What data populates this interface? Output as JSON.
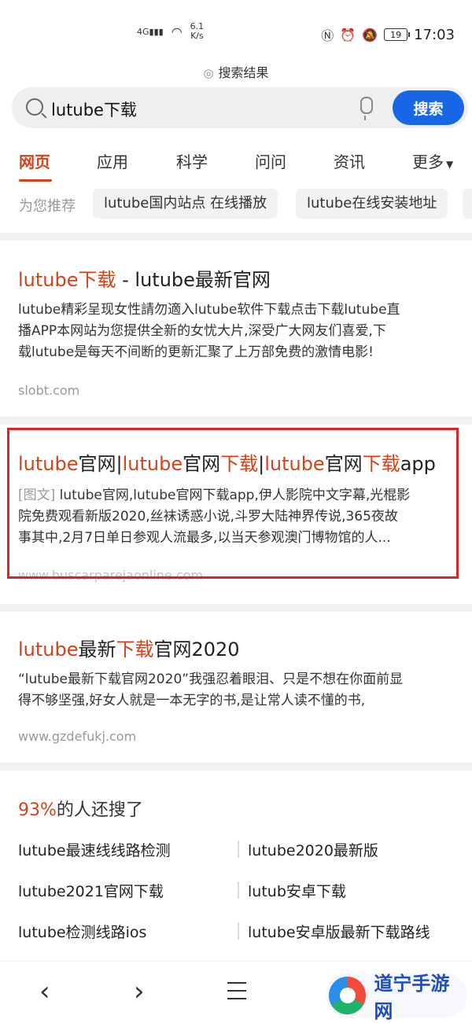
{
  "status_bar": {
    "network": "4G",
    "speed_value": "6.1",
    "speed_unit": "K/s",
    "battery": "19",
    "time": "17:03"
  },
  "header": {
    "label": "搜索结果"
  },
  "search": {
    "query": "lutube下载",
    "button_label": "搜索"
  },
  "tabs": [
    {
      "label": "网页",
      "active": true
    },
    {
      "label": "应用",
      "active": false
    },
    {
      "label": "科学",
      "active": false
    },
    {
      "label": "问问",
      "active": false
    },
    {
      "label": "资讯",
      "active": false
    },
    {
      "label": "更多",
      "active": false
    }
  ],
  "recommendations": {
    "label": "为您推荐",
    "chips": [
      "lutube国内站点 在线播放",
      "lutube在线安装地址"
    ]
  },
  "results": [
    {
      "title_parts": [
        "lutube下载",
        " - lutube最新官网"
      ],
      "snippet_lines": [
        "lutube精彩呈现女性請勿適入lutube软件下载点击下载lutube直",
        "播APP本网站为您提供全新的女忧大片,深受广大网友们喜爱,下",
        "载lutube是每天不间断的更新汇聚了上万部免费的激情电影!"
      ],
      "url": "slobt.com"
    },
    {
      "title_parts": [
        "lutube",
        "官网|",
        "lutube",
        "官网",
        "下载",
        "|",
        "lutube",
        "官网",
        "下载",
        "app"
      ],
      "tag": "[图文]",
      "snippet_lines": [
        "lutube官网,lutube官网下载app,伊人影院中文字幕,光棍影",
        "院免费观看新版2020,丝袜诱惑小说,斗罗大陆神界传说,365夜故",
        "事其中,2月7日单日参观人流最多,以当天参观澳门博物馆的人..."
      ],
      "url": "www.buscarparejaonline.com"
    },
    {
      "title_parts": [
        "lutube",
        "最新",
        "下载",
        "官网2020"
      ],
      "snippet_lines": [
        "“lutube最新下载官网2020”我强忍着眼泪、只是不想在你面前显",
        "得不够坚强,好女人就是一本无字的书,是让常人读不懂的书,"
      ],
      "url": "www.gzdefukj.com"
    }
  ],
  "related": {
    "percent": "93%",
    "title_rest": "的人还搜了",
    "items": [
      "lutube最速线线路检测",
      "lutube2020最新版",
      "lutube2021官网下载",
      "lutub安卓下载",
      "lutube检测线路ios",
      "lutube安卓版最新下载路线"
    ]
  },
  "watermark": {
    "text": "道宁手游网"
  },
  "colors": {
    "accent": "#1766e5",
    "highlight": "#d4421b",
    "box": "#d7252a"
  }
}
